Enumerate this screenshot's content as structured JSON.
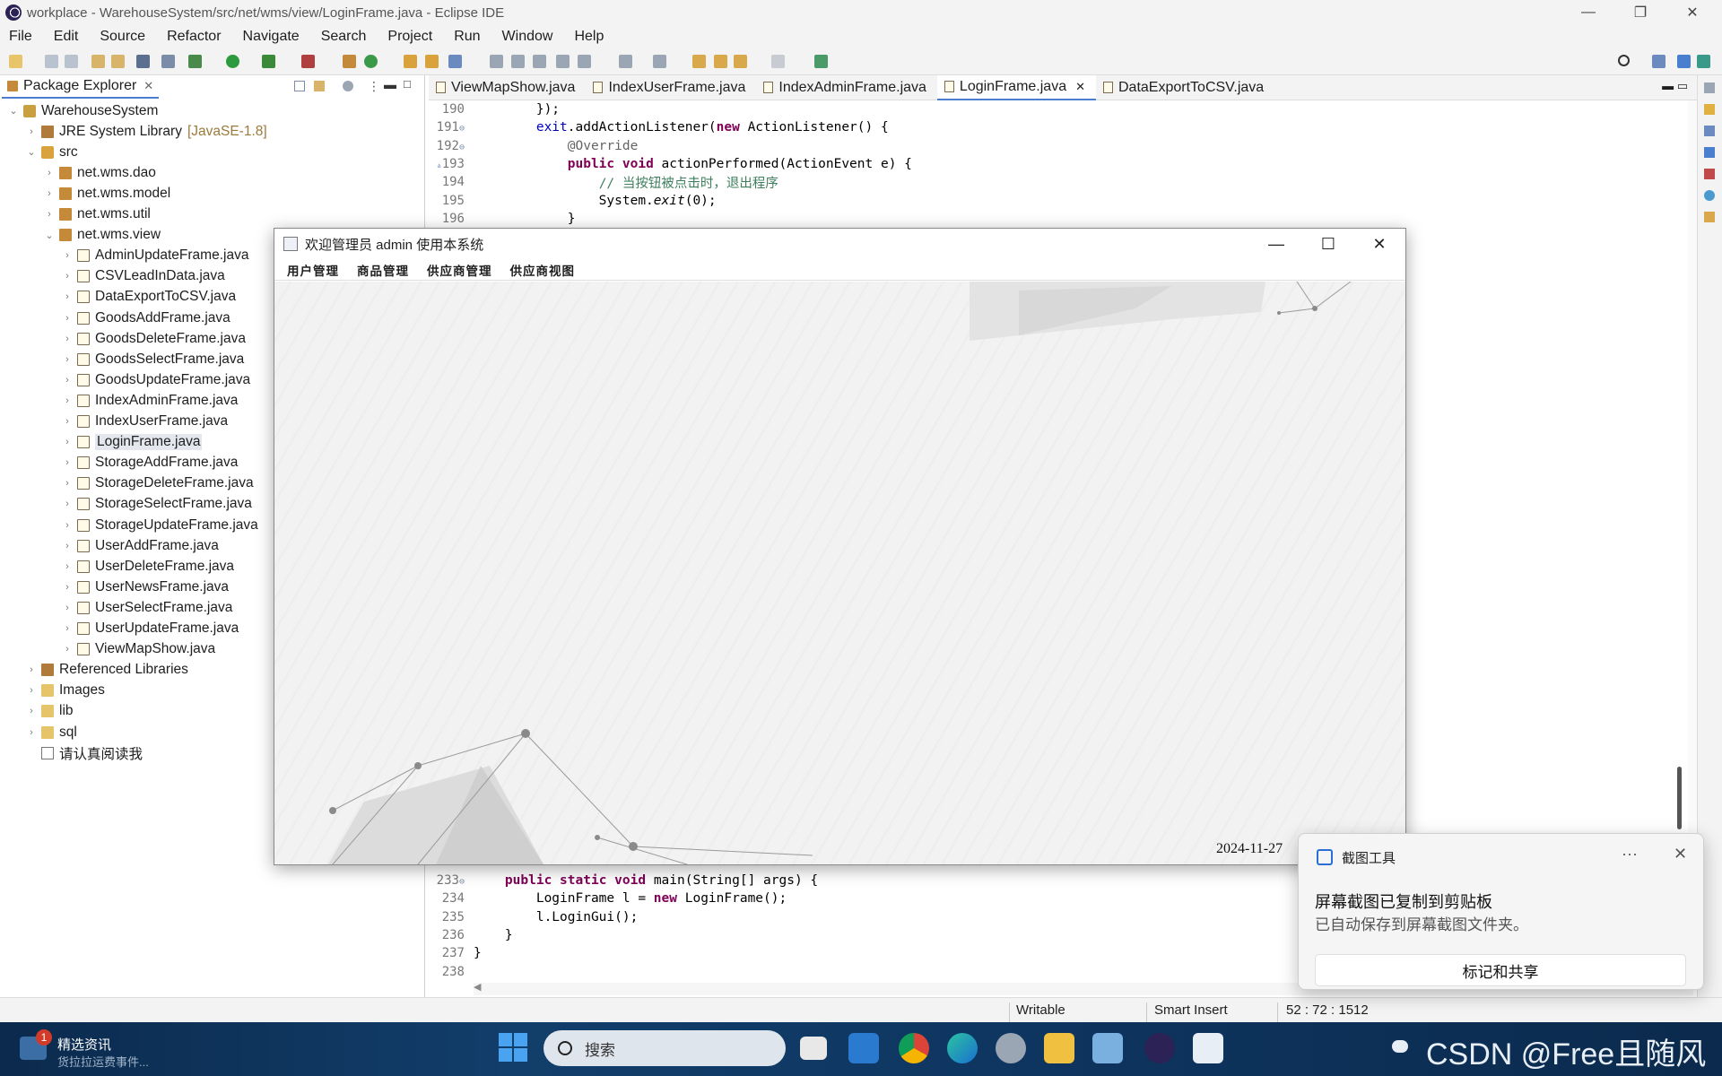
{
  "window": {
    "title": "workplace - WarehouseSystem/src/net/wms/view/LoginFrame.java - Eclipse IDE",
    "minimize": "—",
    "restore": "❐",
    "close": "✕"
  },
  "menu": [
    "File",
    "Edit",
    "Source",
    "Refactor",
    "Navigate",
    "Search",
    "Project",
    "Run",
    "Window",
    "Help"
  ],
  "package_explorer": {
    "tab": "Package Explorer",
    "close": "✕",
    "tree": [
      {
        "label": "WarehouseSystem",
        "icon": "project-icon",
        "depth": 0,
        "expanded": true
      },
      {
        "label": "JRE System Library",
        "suffix": "[JavaSE-1.8]",
        "icon": "library-icon",
        "depth": 1,
        "expanded": false
      },
      {
        "label": "src",
        "icon": "source-folder-icon",
        "depth": 1,
        "expanded": true
      },
      {
        "label": "net.wms.dao",
        "icon": "package-icon",
        "depth": 2,
        "expanded": false
      },
      {
        "label": "net.wms.model",
        "icon": "package-icon",
        "depth": 2,
        "expanded": false
      },
      {
        "label": "net.wms.util",
        "icon": "package-icon",
        "depth": 2,
        "expanded": false
      },
      {
        "label": "net.wms.view",
        "icon": "package-icon",
        "depth": 2,
        "expanded": true
      },
      {
        "label": "AdminUpdateFrame.java",
        "icon": "java-file-icon",
        "depth": 3,
        "expanded": false
      },
      {
        "label": "CSVLeadInData.java",
        "icon": "java-file-icon",
        "depth": 3,
        "expanded": false
      },
      {
        "label": "DataExportToCSV.java",
        "icon": "java-file-icon",
        "depth": 3,
        "expanded": false
      },
      {
        "label": "GoodsAddFrame.java",
        "icon": "java-file-icon",
        "depth": 3,
        "expanded": false
      },
      {
        "label": "GoodsDeleteFrame.java",
        "icon": "java-file-icon",
        "depth": 3,
        "expanded": false
      },
      {
        "label": "GoodsSelectFrame.java",
        "icon": "java-file-icon",
        "depth": 3,
        "expanded": false
      },
      {
        "label": "GoodsUpdateFrame.java",
        "icon": "java-file-icon",
        "depth": 3,
        "expanded": false
      },
      {
        "label": "IndexAdminFrame.java",
        "icon": "java-file-icon",
        "depth": 3,
        "expanded": false
      },
      {
        "label": "IndexUserFrame.java",
        "icon": "java-file-icon",
        "depth": 3,
        "expanded": false
      },
      {
        "label": "LoginFrame.java",
        "icon": "java-file-icon",
        "depth": 3,
        "expanded": false,
        "selected": true
      },
      {
        "label": "StorageAddFrame.java",
        "icon": "java-file-icon",
        "depth": 3,
        "expanded": false
      },
      {
        "label": "StorageDeleteFrame.java",
        "icon": "java-file-icon",
        "depth": 3,
        "expanded": false
      },
      {
        "label": "StorageSelectFrame.java",
        "icon": "java-file-icon",
        "depth": 3,
        "expanded": false
      },
      {
        "label": "StorageUpdateFrame.java",
        "icon": "java-file-icon",
        "depth": 3,
        "expanded": false
      },
      {
        "label": "UserAddFrame.java",
        "icon": "java-file-icon",
        "depth": 3,
        "expanded": false
      },
      {
        "label": "UserDeleteFrame.java",
        "icon": "java-file-icon",
        "depth": 3,
        "expanded": false
      },
      {
        "label": "UserNewsFrame.java",
        "icon": "java-file-icon",
        "depth": 3,
        "expanded": false
      },
      {
        "label": "UserSelectFrame.java",
        "icon": "java-file-icon",
        "depth": 3,
        "expanded": false
      },
      {
        "label": "UserUpdateFrame.java",
        "icon": "java-file-icon",
        "depth": 3,
        "expanded": false
      },
      {
        "label": "ViewMapShow.java",
        "icon": "java-file-icon",
        "depth": 3,
        "expanded": false
      },
      {
        "label": "Referenced Libraries",
        "icon": "library-icon",
        "depth": 1,
        "expanded": false
      },
      {
        "label": "Images",
        "icon": "folder-icon",
        "depth": 1,
        "expanded": false
      },
      {
        "label": "lib",
        "icon": "folder-icon",
        "depth": 1,
        "expanded": false
      },
      {
        "label": "sql",
        "icon": "folder-icon",
        "depth": 1,
        "expanded": false
      },
      {
        "label": "请认真阅读我",
        "icon": "file-icon",
        "depth": 1,
        "leaf": true
      }
    ]
  },
  "editor": {
    "tabs": [
      {
        "label": "ViewMapShow.java",
        "active": false
      },
      {
        "label": "IndexUserFrame.java",
        "active": false
      },
      {
        "label": "IndexAdminFrame.java",
        "active": false
      },
      {
        "label": "LoginFrame.java",
        "active": true
      },
      {
        "label": "DataExportToCSV.java",
        "active": false
      }
    ],
    "tab_close": "✕",
    "top_lines": [
      {
        "n": "190",
        "fold": "",
        "parts": [
          [
            "",
            "        });"
          ]
        ]
      },
      {
        "n": "191",
        "fold": "⊖",
        "parts": [
          [
            "",
            "        "
          ],
          [
            "fld",
            "exit"
          ],
          [
            "",
            ".addActionListener("
          ],
          [
            "kw",
            "new"
          ],
          [
            "",
            " ActionListener() {"
          ]
        ]
      },
      {
        "n": "192",
        "fold": "⊖",
        "parts": [
          [
            "",
            "            "
          ],
          [
            "an",
            "@Override"
          ]
        ]
      },
      {
        "n": "193",
        "fold": "",
        "marker": "▵",
        "parts": [
          [
            "",
            "            "
          ],
          [
            "kw",
            "public"
          ],
          [
            "",
            " "
          ],
          [
            "kw",
            "void"
          ],
          [
            "",
            " actionPerformed(ActionEvent e) {"
          ]
        ]
      },
      {
        "n": "194",
        "fold": "",
        "parts": [
          [
            "",
            "                "
          ],
          [
            "cm",
            "// 当按钮被点击时，退出程序"
          ]
        ]
      },
      {
        "n": "195",
        "fold": "",
        "parts": [
          [
            "",
            "                System."
          ],
          [
            "it",
            "exit"
          ],
          [
            "",
            "(0);"
          ]
        ]
      },
      {
        "n": "196",
        "fold": "",
        "parts": [
          [
            "",
            "            }"
          ]
        ]
      }
    ],
    "bottom_lines": [
      {
        "n": "233",
        "fold": "⊖",
        "parts": [
          [
            "",
            "    "
          ],
          [
            "kw",
            "public"
          ],
          [
            "",
            " "
          ],
          [
            "kw",
            "static"
          ],
          [
            "",
            " "
          ],
          [
            "kw",
            "void"
          ],
          [
            "",
            " main(String[] args) {"
          ]
        ]
      },
      {
        "n": "234",
        "fold": "",
        "parts": [
          [
            "",
            "        LoginFrame l = "
          ],
          [
            "kw",
            "new"
          ],
          [
            "",
            " LoginFrame();"
          ]
        ]
      },
      {
        "n": "235",
        "fold": "",
        "parts": [
          [
            "",
            "        l.LoginGui();"
          ]
        ]
      },
      {
        "n": "236",
        "fold": "",
        "parts": [
          [
            "",
            "    }"
          ]
        ]
      },
      {
        "n": "237",
        "fold": "",
        "parts": [
          [
            "",
            "}"
          ]
        ]
      },
      {
        "n": "238",
        "fold": "",
        "parts": [
          [
            "",
            ""
          ]
        ]
      }
    ]
  },
  "status": {
    "writable": "Writable",
    "insert_mode": "Smart Insert",
    "position": "52 : 72 : 1512"
  },
  "java_frame": {
    "title": "欢迎管理员 admin 使用本系统",
    "minimize": "—",
    "maximize": "☐",
    "close": "✕",
    "menu": [
      "用户管理",
      "商品管理",
      "供应商管理",
      "供应商视图"
    ],
    "date": "2024-11-27"
  },
  "toast": {
    "app": "截图工具",
    "more": "···",
    "close": "✕",
    "headline": "屏幕截图已复制到剪贴板",
    "subtext": "已自动保存到屏幕截图文件夹。",
    "button": "标记和共享"
  },
  "taskbar": {
    "news_badge": "1",
    "news_title": "精选资讯",
    "news_sub": "货拉拉运费事件...",
    "search_label": "搜索",
    "watermark": "CSDN @Free且随风"
  }
}
